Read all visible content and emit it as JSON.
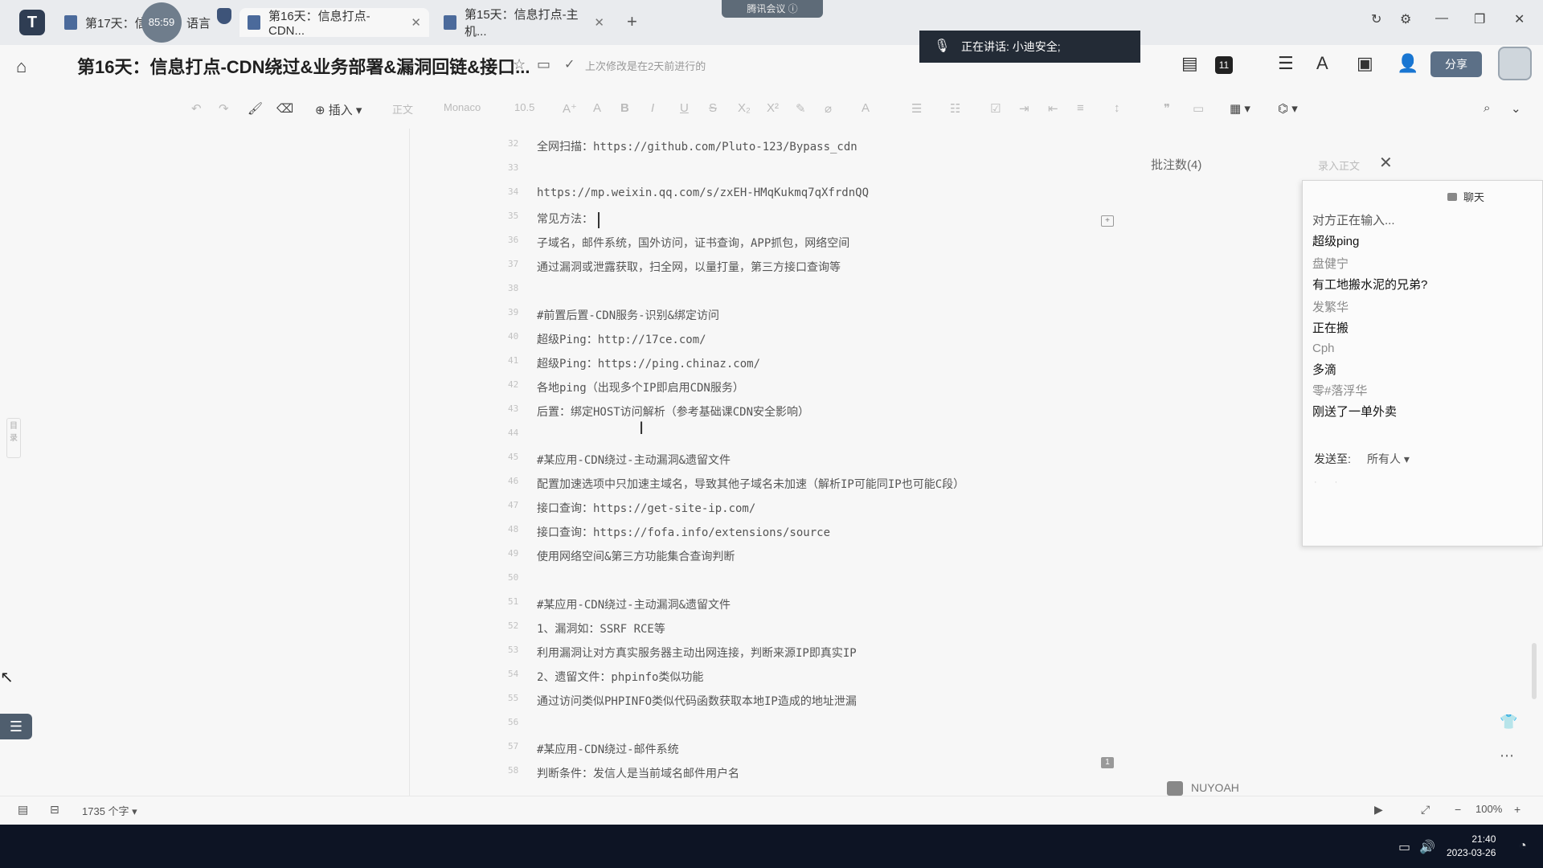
{
  "tabs": [
    {
      "title": "第17天：信",
      "active": false
    },
    {
      "title": "语言",
      "active": false
    },
    {
      "title": "第16天：信息打点-CDN...",
      "active": true
    },
    {
      "title": "第15天：信息打点-主机...",
      "active": false
    }
  ],
  "timer": "85:59",
  "meeting_label": "腾讯会议",
  "title": "第16天：信息打点-CDN绕过&业务部署&漏洞回链&接口...",
  "save_status": "上次修改是在2天前进行的",
  "speaking": "正在讲话: 小迪安全;",
  "participant_count": "11",
  "share_label": "分享",
  "toolbar": {
    "insert_label": "插入",
    "style": "正文",
    "font": "Monaco",
    "size": "10.5"
  },
  "lines": [
    {
      "n": "32",
      "t": "全网扫描：https://github.com/Pluto-123/Bypass_cdn"
    },
    {
      "n": "33",
      "t": ""
    },
    {
      "n": "34",
      "t": "https://mp.weixin.qq.com/s/zxEH-HMqKukmq7qXfrdnQQ"
    },
    {
      "n": "35",
      "t": "常见方法："
    },
    {
      "n": "36",
      "t": "子域名，邮件系统，国外访问，证书查询，APP抓包，网络空间"
    },
    {
      "n": "37",
      "t": "通过漏洞或泄露获取，扫全网，以量打量，第三方接口查询等"
    },
    {
      "n": "38",
      "t": ""
    },
    {
      "n": "39",
      "t": "#前置后置-CDN服务-识别&绑定访问"
    },
    {
      "n": "40",
      "t": "超级Ping：http://17ce.com/"
    },
    {
      "n": "41",
      "t": "超级Ping：https://ping.chinaz.com/"
    },
    {
      "n": "42",
      "t": "各地ping（出现多个IP即启用CDN服务）"
    },
    {
      "n": "43",
      "t": "后置：绑定HOST访问解析（参考基础课CDN安全影响）"
    },
    {
      "n": "44",
      "t": ""
    },
    {
      "n": "45",
      "t": "#某应用-CDN绕过-主动漏洞&遗留文件"
    },
    {
      "n": "46",
      "t": "配置加速选项中只加速主域名，导致其他子域名未加速（解析IP可能同IP也可能C段）"
    },
    {
      "n": "47",
      "t": "接口查询：https://get-site-ip.com/"
    },
    {
      "n": "48",
      "t": "接口查询：https://fofa.info/extensions/source"
    },
    {
      "n": "49",
      "t": "使用网络空间&第三方功能集合查询判断"
    },
    {
      "n": "50",
      "t": ""
    },
    {
      "n": "51",
      "t": "#某应用-CDN绕过-主动漏洞&遗留文件"
    },
    {
      "n": "52",
      "t": "1、漏洞如：SSRF RCE等"
    },
    {
      "n": "53",
      "t": "利用漏洞让对方真实服务器主动出网连接，判断来源IP即真实IP"
    },
    {
      "n": "54",
      "t": "2、遗留文件：phpinfo类似功能"
    },
    {
      "n": "55",
      "t": "通过访问类似PHPINFO类似代码函数获取本地IP造成的地址泄漏"
    },
    {
      "n": "56",
      "t": ""
    },
    {
      "n": "57",
      "t": "#某应用-CDN绕过-邮件系统"
    },
    {
      "n": "58",
      "t": "判断条件：发信人是当前域名邮件用户名"
    }
  ],
  "comments": {
    "header": "批注数(4)",
    "insert_link": "录入正文"
  },
  "chat": {
    "title": "聊天",
    "typing": "对方正在输入...",
    "messages": [
      {
        "name": "",
        "text": "超级ping"
      },
      {
        "name": "盘健宁",
        "text": "有工地搬水泥的兄弟?"
      },
      {
        "name": "发繁华",
        "text": "正在搬"
      },
      {
        "name": "Cph",
        "text": "多滴"
      },
      {
        "name": "零#落浮华",
        "text": "刚送了一单外卖"
      }
    ],
    "send_to_label": "发送至:",
    "send_to_value": "所有人"
  },
  "bottom_user": "NUYOAH",
  "word_count": "1735 个字",
  "zoom": "100%",
  "clock": {
    "time": "21:40",
    "date": "2023-03-26"
  }
}
